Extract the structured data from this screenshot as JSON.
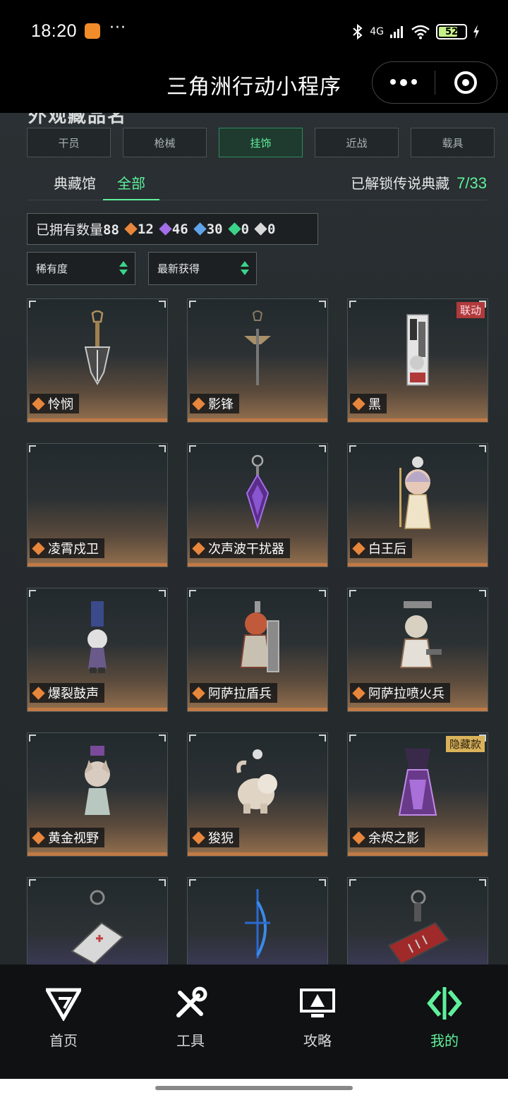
{
  "status_bar": {
    "time": "18:20",
    "dots": "···",
    "network": "4G",
    "battery": "52"
  },
  "title_bar": {
    "title": "三角洲行动小程序"
  },
  "page": {
    "section_title": "外观藏品名",
    "category_tabs": [
      "干员",
      "枪械",
      "挂饰",
      "近战",
      "载具"
    ],
    "active_category": "挂饰",
    "sub_tabs": [
      "典藏馆",
      "全部"
    ],
    "active_sub_tab": "全部",
    "unlock_label": "已解锁传说典藏",
    "unlock_value": "7/33",
    "owned": {
      "label": "已拥有数量",
      "total": "88",
      "gold": "12",
      "purple": "46",
      "blue": "30",
      "green": "0",
      "white": "0"
    },
    "filters": {
      "rarity": "稀有度",
      "sort": "最新获得"
    }
  },
  "items": [
    {
      "name": "怜悯",
      "badge": ""
    },
    {
      "name": "影锋",
      "badge": ""
    },
    {
      "name": "黑",
      "badge": "联动"
    },
    {
      "name": "凌霄戍卫",
      "badge": ""
    },
    {
      "name": "次声波干扰器",
      "badge": ""
    },
    {
      "name": "白王后",
      "badge": ""
    },
    {
      "name": "爆裂鼓声",
      "badge": ""
    },
    {
      "name": "阿萨拉盾兵",
      "badge": ""
    },
    {
      "name": "阿萨拉喷火兵",
      "badge": ""
    },
    {
      "name": "黄金视野",
      "badge": ""
    },
    {
      "name": "狻猊",
      "badge": ""
    },
    {
      "name": "余烬之影",
      "badge": "隐藏款"
    }
  ],
  "tab_bar": {
    "home": "首页",
    "tools": "工具",
    "guide": "攻略",
    "mine": "我的",
    "active": "我的"
  },
  "colors": {
    "accent": "#5ff09b",
    "gold": "#e8863c",
    "purple": "#a36ee8",
    "blue": "#5fa3ea"
  },
  "icons": [
    "bluetooth-icon",
    "signal-icon",
    "wifi-icon",
    "battery-icon",
    "more-icon",
    "target-icon",
    "logo-home-icon",
    "tools-icon",
    "guide-icon",
    "mine-icon"
  ]
}
